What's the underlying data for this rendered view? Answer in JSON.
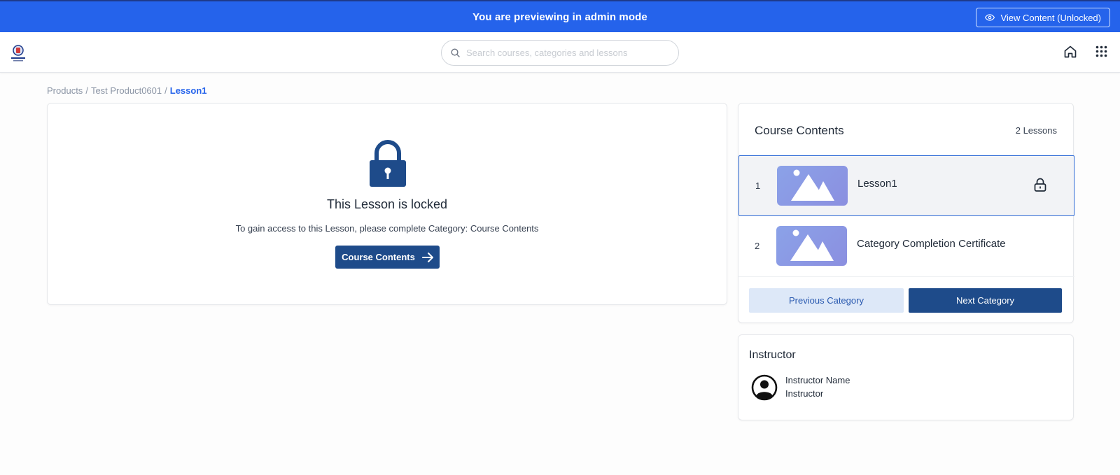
{
  "admin_banner": {
    "message": "You are previewing in admin mode",
    "view_button_label": "View Content (Unlocked)"
  },
  "header": {
    "search_placeholder": "Search courses, categories and lessons",
    "icons": [
      "search-icon",
      "home-icon",
      "apps-grid-icon"
    ]
  },
  "breadcrumb": {
    "items": [
      "Products",
      "Test Product0601"
    ],
    "separator": "/",
    "current": "Lesson1"
  },
  "locked_panel": {
    "title": "This Lesson is locked",
    "description": "To gain access to this Lesson, please complete Category: Course Contents",
    "button_label": "Course Contents",
    "icon": "padlock-icon"
  },
  "course_contents": {
    "title": "Course Contents",
    "count_label": "2 Lessons",
    "lessons": [
      {
        "number": "1",
        "title": "Lesson1",
        "locked": true,
        "active": true
      },
      {
        "number": "2",
        "title": "Category Completion Certificate",
        "locked": false,
        "active": false
      }
    ],
    "previous_label": "Previous Category",
    "next_label": "Next Category"
  },
  "instructor": {
    "heading": "Instructor",
    "name": "Instructor Name",
    "role": "Instructor"
  },
  "colors": {
    "banner": "#2563eb",
    "primary_button": "#1e4b8a",
    "secondary_button": "#dde8f8",
    "active_border": "#2f6bd6"
  }
}
